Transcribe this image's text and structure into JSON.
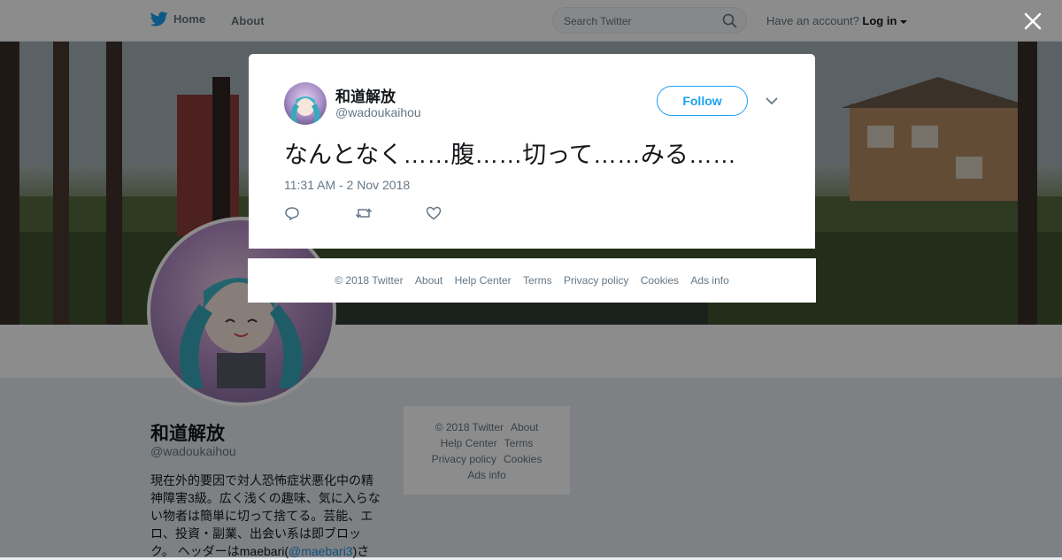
{
  "nav": {
    "home_label": "Home",
    "about_label": "About",
    "search_placeholder": "Search Twitter",
    "account_prompt": "Have an account?",
    "login_label": "Log in"
  },
  "profile": {
    "name": "和道解放",
    "handle": "@wadoukaihou",
    "bio_text": "現在外的要因で対人恐怖症状悪化中の精神障害3級。広く浅くの趣味、気に入らない物者は簡単に切って捨てる。芸能、エロ、投資・副業、出会い系は即ブロック。 ヘッダーはmaebari(",
    "bio_link": "@maebari3",
    "bio_tail": ")さ"
  },
  "side_footer": {
    "links": [
      "© 2018 Twitter",
      "About",
      "Help Center",
      "Terms",
      "Privacy policy",
      "Cookies",
      "Ads info"
    ]
  },
  "tweet": {
    "author_name": "和道解放",
    "author_handle": "@wadoukaihou",
    "follow_label": "Follow",
    "text": "なんとなく……腹……切って……みる……",
    "timestamp": "11:31 AM - 2 Nov 2018"
  },
  "modal_footer": {
    "links": [
      "© 2018 Twitter",
      "About",
      "Help Center",
      "Terms",
      "Privacy policy",
      "Cookies",
      "Ads info"
    ]
  },
  "colors": {
    "brand": "#1da1f2",
    "text": "#14171a",
    "muted": "#657786"
  },
  "icons": [
    "twitter-bird-icon",
    "search-icon",
    "caret-down-icon",
    "close-icon",
    "chevron-down-icon",
    "reply-icon",
    "retweet-icon",
    "like-icon"
  ]
}
